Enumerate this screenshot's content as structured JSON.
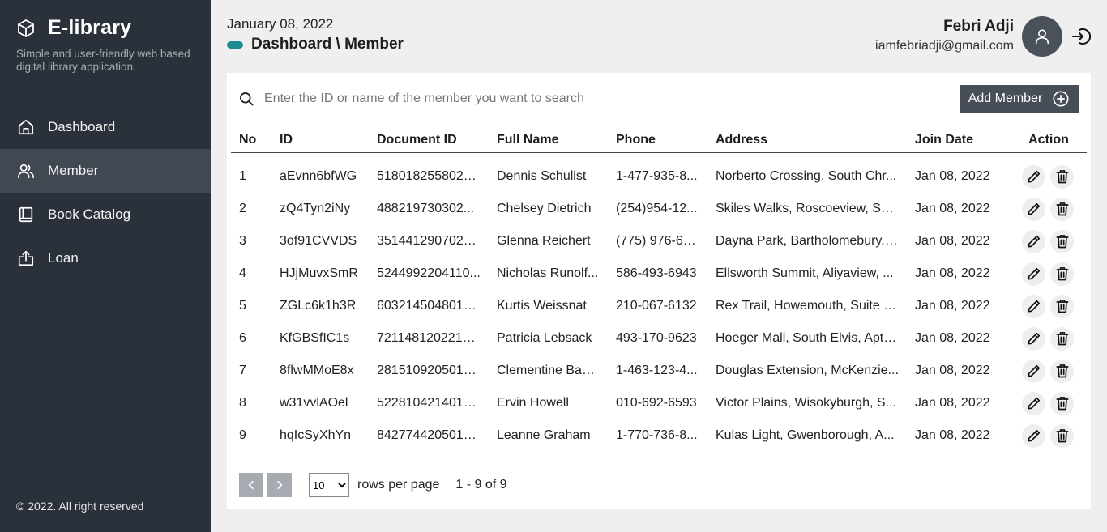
{
  "app": {
    "title": "E-library",
    "subtitle": "Simple and user-friendly web based digital library application.",
    "footer": "2022. All right reserved",
    "copyright_symbol": "©"
  },
  "nav": [
    {
      "label": "Dashboard",
      "icon": "home-icon"
    },
    {
      "label": "Member",
      "icon": "users-icon",
      "active": true
    },
    {
      "label": "Book Catalog",
      "icon": "book-icon"
    },
    {
      "label": "Loan",
      "icon": "upload-icon"
    }
  ],
  "header": {
    "date": "January 08, 2022",
    "breadcrumb": "Dashboard \\ Member",
    "user_name": "Febri Adji",
    "user_email": "iamfebriadji@gmail.com"
  },
  "search": {
    "placeholder": "Enter the ID or name of the member you want to search",
    "value": ""
  },
  "add_button": "Add Member",
  "table": {
    "columns": [
      "No",
      "ID",
      "Document ID",
      "Full Name",
      "Phone",
      "Address",
      "Join Date",
      "Action"
    ],
    "rows": [
      [
        "1",
        "aEvnn6bfWG",
        "5180182558020...",
        "Dennis Schulist",
        "1-477-935-8...",
        "Norberto Crossing, South Chr...",
        "Jan 08, 2022"
      ],
      [
        "2",
        "zQ4Tyn2iNy",
        "488219730302...",
        "Chelsey Dietrich",
        "(254)954-12...",
        "Skiles Walks, Roscoeview, Sui...",
        "Jan 08, 2022"
      ],
      [
        "3",
        "3of91CVVDS",
        "3514412907020...",
        "Glenna Reichert",
        "(775) 976-67...",
        "Dayna Park, Bartholomebury, ...",
        "Jan 08, 2022"
      ],
      [
        "4",
        "HJjMuvxSmR",
        "5244992204110...",
        "Nicholas Runolf...",
        "586-493-6943",
        "Ellsworth Summit, Aliyaview, ...",
        "Jan 08, 2022"
      ],
      [
        "5",
        "ZGLc6k1h3R",
        "6032145048010...",
        "Kurtis Weissnat",
        "210-067-6132",
        "Rex Trail, Howemouth, Suite 2...",
        "Jan 08, 2022"
      ],
      [
        "6",
        "KfGBSfIC1s",
        "72114812022100...",
        "Patricia Lebsack",
        "493-170-9623",
        "Hoeger Mall, South Elvis, Apt. ...",
        "Jan 08, 2022"
      ],
      [
        "7",
        "8flwMMoE8x",
        "2815109205010...",
        "Clementine Bau...",
        "1-463-123-4...",
        "Douglas Extension, McKenzie...",
        "Jan 08, 2022"
      ],
      [
        "8",
        "w31vvlAOel",
        "5228104214010...",
        "Ervin Howell",
        "010-692-6593",
        "Victor Plains, Wisokyburgh, S...",
        "Jan 08, 2022"
      ],
      [
        "9",
        "hqIcSyXhYn",
        "8427744205010...",
        "Leanne Graham",
        "1-770-736-8...",
        "Kulas Light, Gwenborough, A...",
        "Jan 08, 2022"
      ]
    ]
  },
  "pagination": {
    "rows_per_page_value": "10",
    "rows_per_page_label": "rows per page",
    "range": "1 - 9 of 9"
  }
}
